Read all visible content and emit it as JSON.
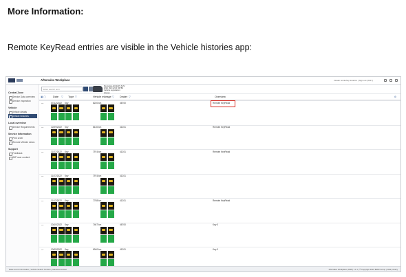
{
  "doc": {
    "heading": "More Information:",
    "intro": "Remote KeyRead entries are visible in the Vehicle histories app:"
  },
  "app": {
    "title": "Aftersales Workplace",
    "topbar_right": "Dealer workshop location | Sign out (2017)",
    "search_placeholder": "Enter search term",
    "vehicle": {
      "line1": "Mercedes-EQ EQS SUV",
      "line2": "W1K 296 123 4 56789",
      "line3": "Vehicle registration",
      "line4": "History"
    },
    "sidebar": [
      {
        "type": "group",
        "label": "Central Zone"
      },
      {
        "type": "item",
        "label": "Service Data overview"
      },
      {
        "type": "item",
        "label": "Service inspection"
      },
      {
        "type": "group",
        "label": "Vehicle"
      },
      {
        "type": "item",
        "label": "Vehicle details"
      },
      {
        "type": "item",
        "label": "Vehicle histories",
        "active": true
      },
      {
        "type": "group",
        "label": "Local overview"
      },
      {
        "type": "item",
        "label": "Service Requirements"
      },
      {
        "type": "group",
        "label": "Service Information"
      },
      {
        "type": "item",
        "label": "Print order"
      },
      {
        "type": "item",
        "label": "Remote Vehicle views"
      },
      {
        "type": "group",
        "label": "Support"
      },
      {
        "type": "item",
        "label": "Feedback"
      },
      {
        "type": "item",
        "label": "WIP user content"
      }
    ],
    "columns": {
      "date": "Date",
      "type": "Type",
      "mileage": "Vehicle mileage",
      "dealer": "Dealer",
      "overview": "Overview"
    },
    "history_rows": [
      {
        "date": "07/12/2022",
        "type": "Key",
        "mileage": "8220 km",
        "dealer": "46700",
        "overview": "Remote KeyRead"
      },
      {
        "date": "12/09/2022",
        "type": "Key",
        "mileage": "8130 km",
        "dealer": "41201",
        "overview": "Remote KeyRead"
      },
      {
        "date": "11/27/2022",
        "type": "Key",
        "mileage": "7974 km",
        "dealer": "41201",
        "overview": "Remote KeyRead"
      },
      {
        "date": "11/27/2022",
        "type": "Key",
        "mileage": "7974 km",
        "dealer": "41201",
        "overview": ""
      },
      {
        "date": "11/12/2022",
        "type": "Key",
        "mileage": "7708 km",
        "dealer": "41201",
        "overview": "Remote KeyRead"
      },
      {
        "date": "10/10/2022",
        "type": "Key",
        "mileage": "7467 km",
        "dealer": "46700",
        "overview": "Key 0"
      },
      {
        "date": "10/05/2022",
        "type": "Key",
        "mileage": "6940 km",
        "dealer": "41201",
        "overview": "Key 0"
      }
    ],
    "statusbar_left": "Data record information | Vehicle Search function | Standard version",
    "statusbar_right": "Aftersales Workplace (AWP) 1.1.1 | © Copyright 2022 BMW Group | Data privacy"
  },
  "colors": {
    "highlight": "#d8261c",
    "key_tile_dark": "#1d1a12",
    "key_tile_green": "#24a847",
    "nav_active": "#2f4a73"
  }
}
